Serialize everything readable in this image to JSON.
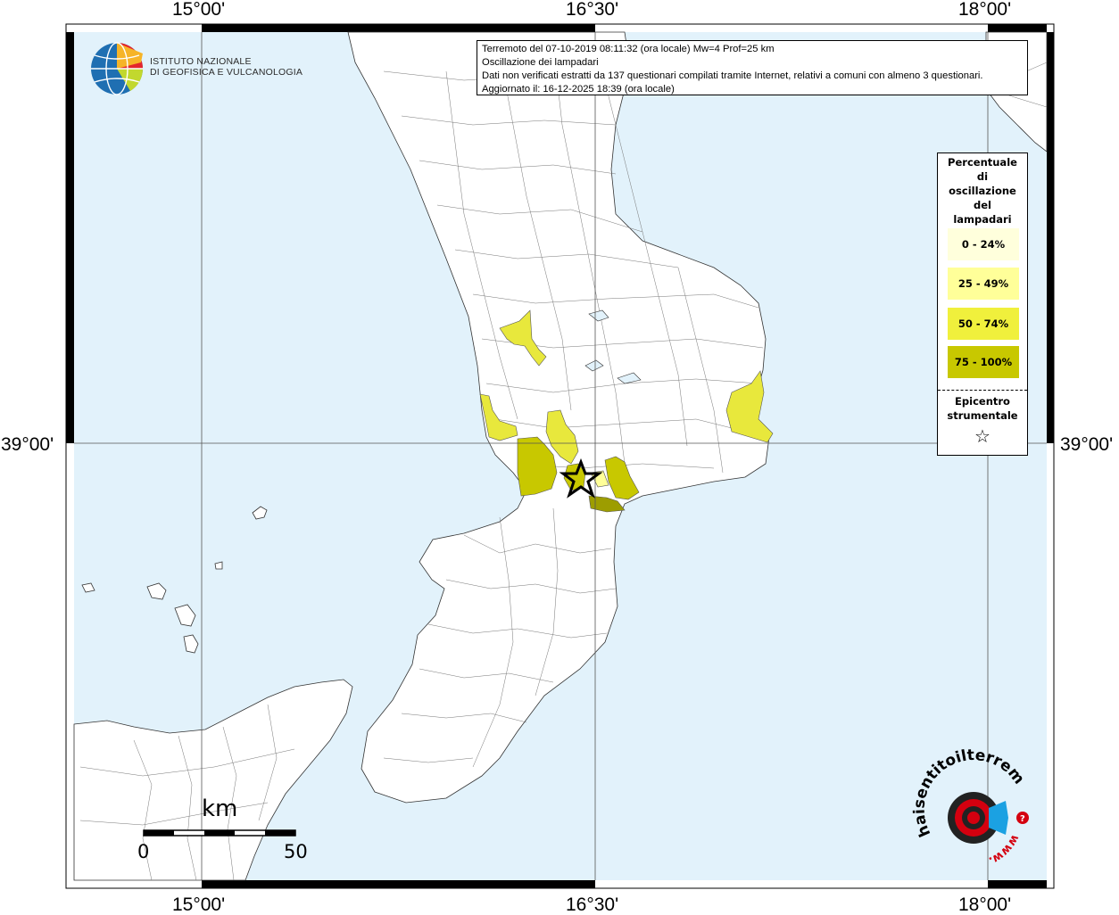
{
  "info": {
    "line1": "Terremoto del 07-10-2019 08:11:32 (ora locale) Mw=4 Prof=25 km",
    "line2": "Oscillazione dei lampadari",
    "line3": "Dati non verificati estratti da 137 questionari compilati tramite Internet, relativi a comuni con almeno 3 questionari.",
    "line4": "Aggiornato il: 16-12-2025 18:39 (ora locale)"
  },
  "axes": {
    "top_labels": [
      "15°00'",
      "16°30'",
      "18°00'"
    ],
    "bottom_labels": [
      "15°00'",
      "16°30'",
      "18°00'"
    ],
    "left_label": "39°00'",
    "right_label": "39°00'"
  },
  "logo": {
    "line1": "ISTITUTO NAZIONALE",
    "line2": "DI GEOFISICA E VULCANOLOGIA"
  },
  "legend": {
    "title": [
      "Percentuale",
      "di",
      "oscillazione",
      "del",
      "lampadari"
    ],
    "classes": [
      {
        "label": "0 - 24%",
        "color": "#ffffdc"
      },
      {
        "label": "25 - 49%",
        "color": "#ffff99"
      },
      {
        "label": "50 - 74%",
        "color": "#f0f03c"
      },
      {
        "label": "75 - 100%",
        "color": "#c8c800"
      }
    ],
    "epicenter_label": [
      "Epicentro",
      "strumentale"
    ],
    "epicenter_symbol": "☆"
  },
  "scale": {
    "unit": "km",
    "start": "0",
    "end": "50"
  },
  "brand": {
    "text": "haisentitoilterremoto.it",
    "prefix": "www.",
    "accent": "#d4000f"
  },
  "colors": {
    "sea": "#e2f2fb",
    "land": "#ffffff"
  }
}
